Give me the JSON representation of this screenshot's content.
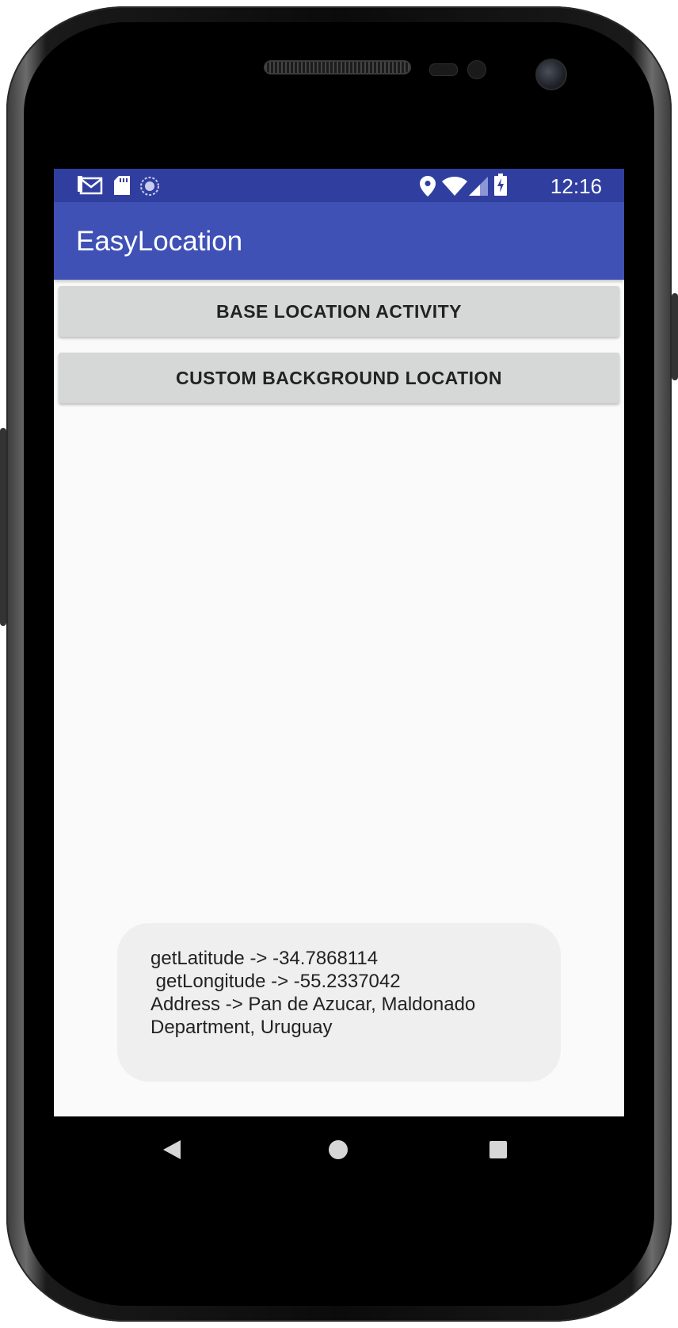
{
  "status_bar": {
    "time": "12:16",
    "left_icons": [
      "gmail-icon",
      "sd-card-icon",
      "sync-icon"
    ],
    "right_icons": [
      "location-icon",
      "wifi-icon",
      "signal-icon",
      "battery-charging-icon"
    ]
  },
  "app_bar": {
    "title": "EasyLocation"
  },
  "buttons": {
    "base_location": "BASE LOCATION ACTIVITY",
    "custom_background": "CUSTOM BACKGROUND LOCATION"
  },
  "toast": {
    "text": "getLatitude -> -34.7868114\n getLongitude -> -55.2337042\nAddress -> Pan de Azucar, Maldonado\nDepartment, Uruguay"
  },
  "nav_bar": {
    "icons": [
      "back-icon",
      "home-icon",
      "recents-icon"
    ]
  },
  "colors": {
    "status_bar": "#303f9f",
    "app_bar": "#3f51b5",
    "button": "#d6d7d7",
    "background": "#fafafa"
  }
}
